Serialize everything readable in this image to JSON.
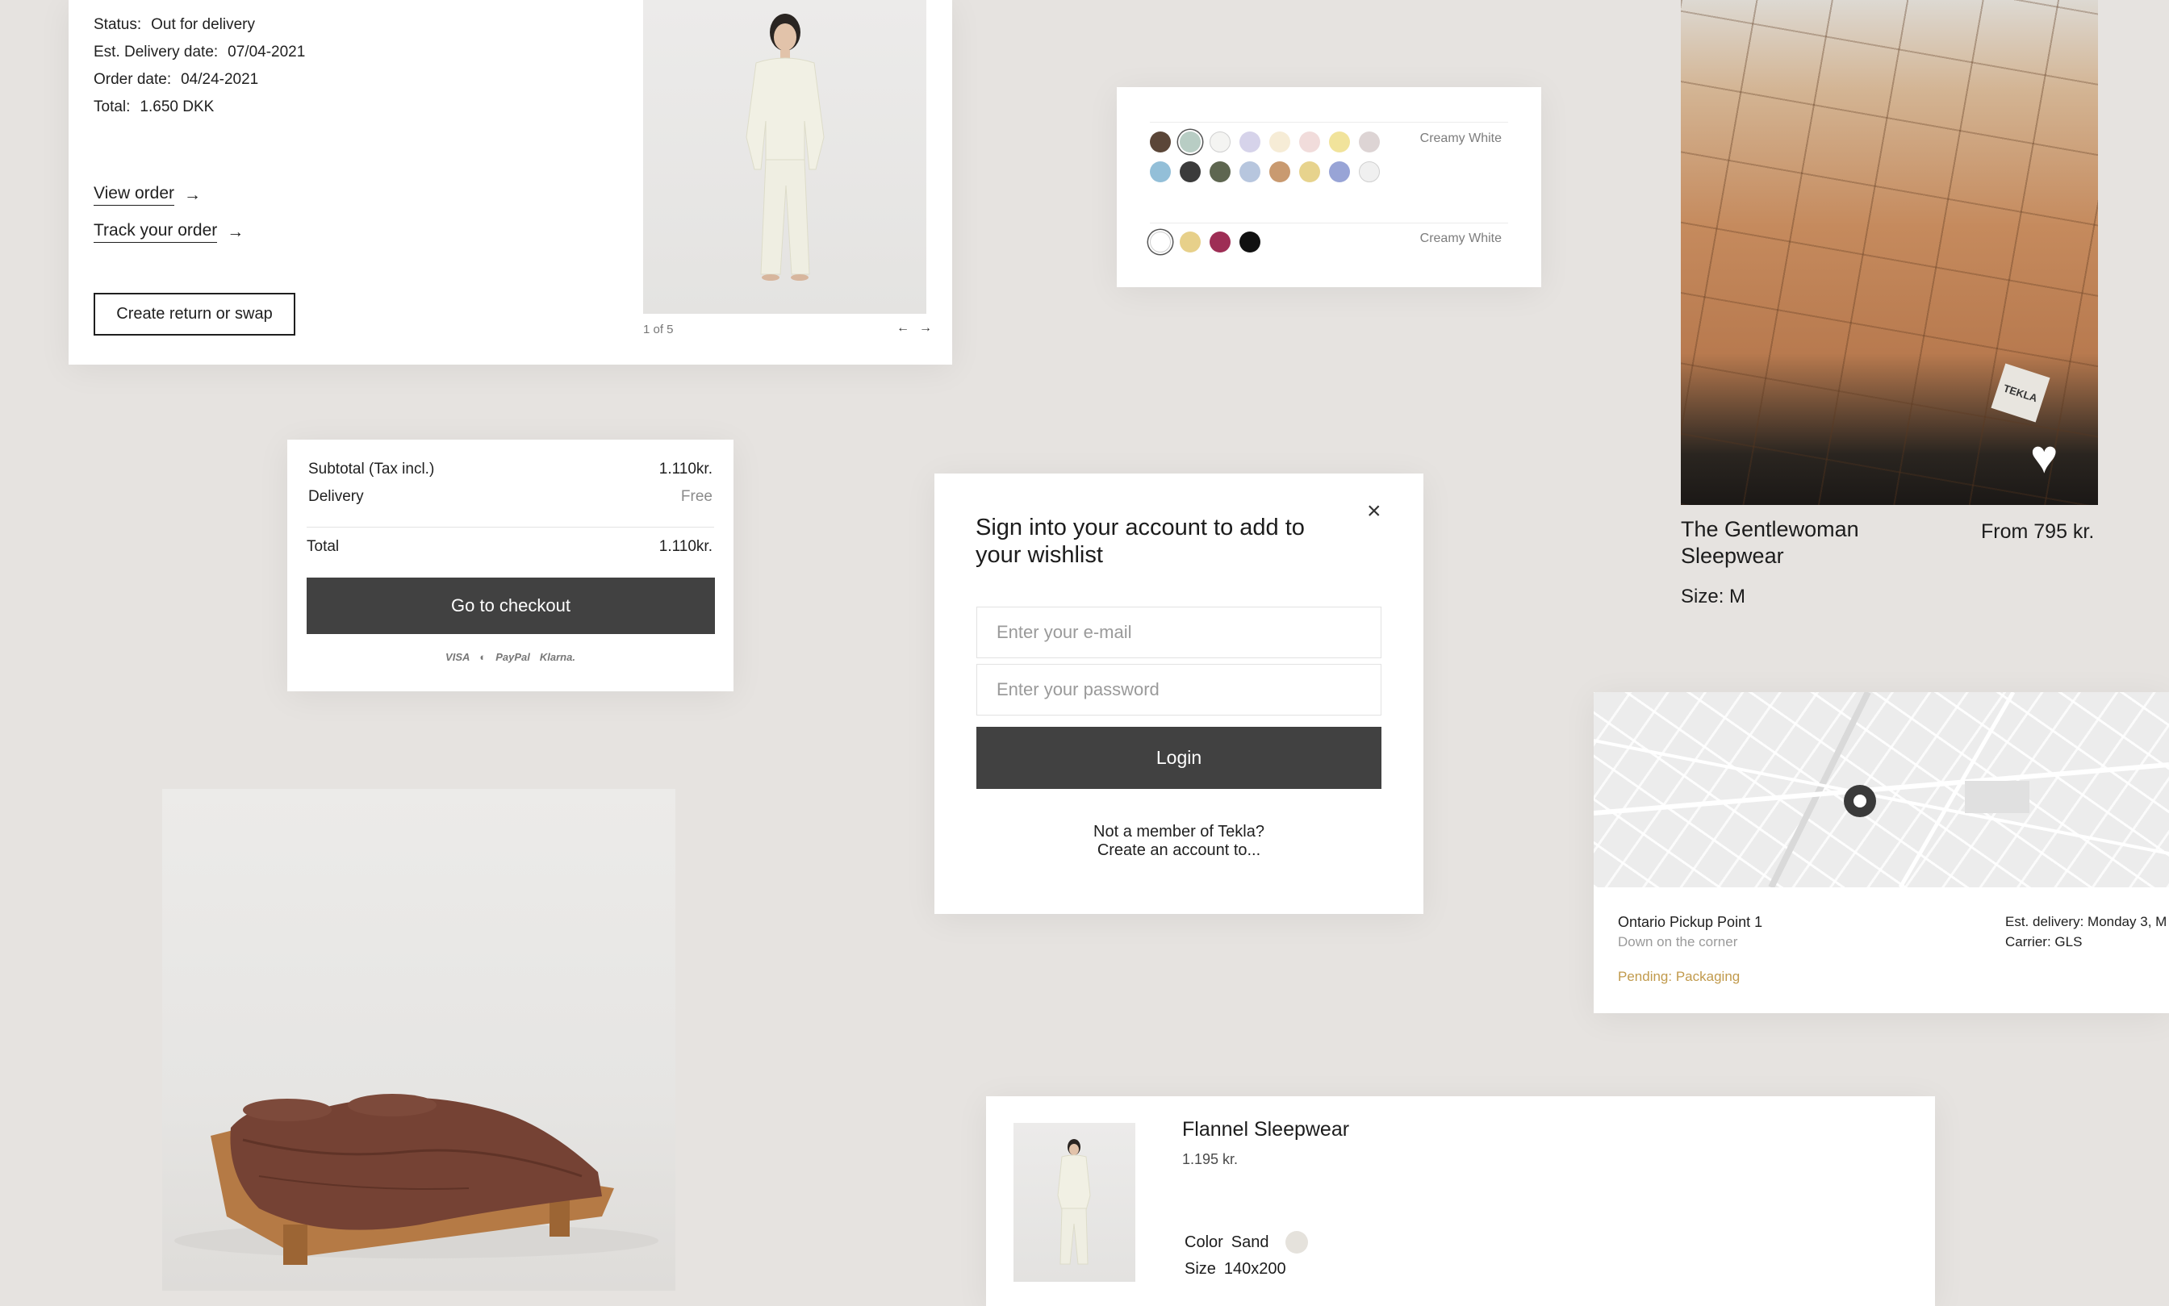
{
  "order": {
    "status_label": "Status:",
    "status_value": "Out for delivery",
    "est_label": "Est. Delivery date:",
    "est_value": "07/04-2021",
    "date_label": "Order date:",
    "date_value": "04/24-2021",
    "total_label": "Total:",
    "total_value": "1.650 DKK",
    "view_order": "View order",
    "track_order": "Track your order",
    "return_button": "Create return or swap",
    "pager": "1 of 5",
    "prev_arrow": "←",
    "next_arrow": "→",
    "link_arrow": "→"
  },
  "swatches": {
    "row_label_1": "Creamy White",
    "row_label_2": "Creamy White",
    "row1": [
      "#5b4638",
      "#b8cdc4",
      "#f4f4f2",
      "#d6d3ea",
      "#f6ecd6",
      "#f1dcdb",
      "#f1e39b",
      "#ddd4d4"
    ],
    "row2": [
      "#93bfd8",
      "#3b3b3b",
      "#5e6650",
      "#b7c6de",
      "#c99a70",
      "#e7d38d",
      "#98a4d6",
      "#f0f0f0"
    ],
    "row3": [
      "#ffffff",
      "#e7d08a",
      "#9e2e55",
      "#111111"
    ]
  },
  "product": {
    "title": "The Gentlewoman Sleepwear",
    "price": "From 795 kr.",
    "size": "Size: M",
    "tag": "TEKLA"
  },
  "summary": {
    "subtotal_label": "Subtotal (Tax incl.)",
    "subtotal_value": "1.110kr.",
    "delivery_label": "Delivery",
    "delivery_value": "Free",
    "total_label": "Total",
    "total_value": "1.110kr.",
    "checkout_button": "Go to checkout",
    "payments": [
      "VISA",
      "◐",
      "PayPal",
      "Klarna."
    ]
  },
  "login": {
    "title": "Sign into your account to add to your wishlist",
    "close": "×",
    "email_placeholder": "Enter your e-mail",
    "password_placeholder": "Enter your password",
    "login_button": "Login",
    "member_line1": "Not a member of Tekla?",
    "member_line2": "Create an account to..."
  },
  "pickup": {
    "name": "Ontario Pickup Point 1",
    "subtitle": "Down on the corner",
    "status": "Pending: Packaging",
    "est_delivery": "Est. delivery: Monday 3, M",
    "carrier": "Carrier: GLS"
  },
  "flannel": {
    "title": "Flannel Sleepwear",
    "price": "1.195 kr.",
    "color_label": "Color",
    "color_value": "Sand",
    "size_label": "Size",
    "size_value": "140x200"
  },
  "colors": {
    "dark_button": "#414141",
    "status_pending": "#c19a4c"
  }
}
